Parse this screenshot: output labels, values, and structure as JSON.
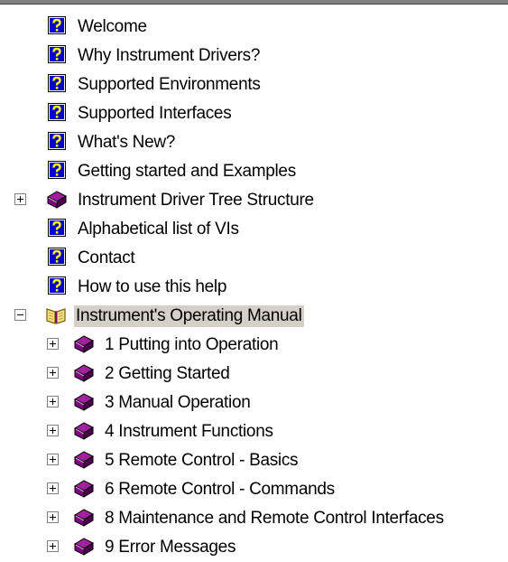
{
  "tree": {
    "items": [
      {
        "label": "Welcome",
        "icon": "help-topic-icon"
      },
      {
        "label": "Why Instrument Drivers?",
        "icon": "help-topic-icon"
      },
      {
        "label": "Supported Environments",
        "icon": "help-topic-icon"
      },
      {
        "label": "Supported Interfaces",
        "icon": "help-topic-icon"
      },
      {
        "label": "What's New?",
        "icon": "help-topic-icon"
      },
      {
        "label": "Getting started and Examples",
        "icon": "help-topic-icon"
      },
      {
        "label": "Instrument Driver Tree Structure",
        "icon": "closed-book-icon",
        "expander": "plus-icon"
      },
      {
        "label": "Alphabetical list of VIs",
        "icon": "help-topic-icon"
      },
      {
        "label": "Contact",
        "icon": "help-topic-icon"
      },
      {
        "label": "How to use this help",
        "icon": "help-topic-icon"
      },
      {
        "label": "Instrument's Operating Manual",
        "icon": "open-book-icon",
        "expander": "minus-icon",
        "selected": true
      },
      {
        "label": "1 Putting into Operation",
        "icon": "closed-book-icon",
        "expander": "plus-icon"
      },
      {
        "label": "2 Getting Started",
        "icon": "closed-book-icon",
        "expander": "plus-icon"
      },
      {
        "label": "3 Manual Operation",
        "icon": "closed-book-icon",
        "expander": "plus-icon"
      },
      {
        "label": "4 Instrument Functions",
        "icon": "closed-book-icon",
        "expander": "plus-icon"
      },
      {
        "label": "5 Remote Control - Basics",
        "icon": "closed-book-icon",
        "expander": "plus-icon"
      },
      {
        "label": "6 Remote Control - Commands",
        "icon": "closed-book-icon",
        "expander": "plus-icon"
      },
      {
        "label": "8 Maintenance and Remote Control Interfaces",
        "icon": "closed-book-icon",
        "expander": "plus-icon"
      },
      {
        "label": "9 Error Messages",
        "icon": "closed-book-icon",
        "expander": "plus-icon"
      }
    ]
  },
  "colors": {
    "selection_background": "#d4d0c8",
    "help_icon_blue": "#0000cc",
    "help_icon_yellow": "#ffff00",
    "book_purple": "#7f007f"
  }
}
